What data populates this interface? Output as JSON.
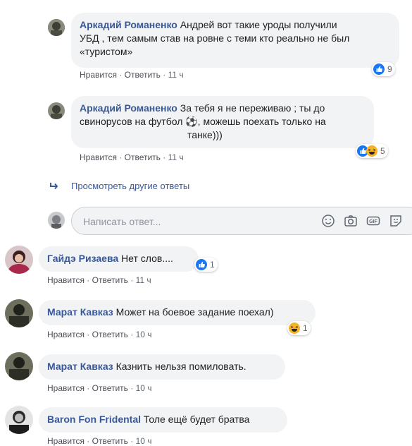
{
  "comments": [
    {
      "id": "c1",
      "author": "Аркадий Романенко",
      "text_lines": [
        "Андрей вот такие уроды получили",
        "УБД , тем самым став на ровне с теми кто реально не был",
        "«туристом»"
      ],
      "actions": {
        "like": "Нравится",
        "reply": "Ответить",
        "time": "11 ч"
      },
      "reaction_count": "9",
      "reactions": [
        "like-icon"
      ]
    },
    {
      "id": "c2",
      "author": "Аркадий Романенко",
      "text_lines": [
        "За тебя я не переживаю ; ты до",
        "свинорусов на футбол ⚽, можешь поехать только на",
        "танке)))"
      ],
      "actions": {
        "like": "Нравится",
        "reply": "Ответить",
        "time": "11 ч"
      },
      "reaction_count": "5",
      "reactions": [
        "like-icon",
        "haha-icon"
      ]
    },
    {
      "id": "c3",
      "author": "Гайдэ Ризаева",
      "text": "Нет слов....",
      "actions": {
        "like": "Нравится",
        "reply": "Ответить",
        "time": "11 ч"
      },
      "reaction_count": "1",
      "reactions": [
        "like-icon"
      ]
    },
    {
      "id": "c4",
      "author": "Марат Кавказ",
      "text": "Может на боевое задание поехал)",
      "actions": {
        "like": "Нравится",
        "reply": "Ответить",
        "time": "10 ч"
      },
      "reaction_count": "1",
      "reactions": [
        "haha-icon"
      ]
    },
    {
      "id": "c5",
      "author": "Марат Кавказ",
      "text": "Казнить нельзя помиловать.",
      "actions": {
        "like": "Нравится",
        "reply": "Ответить",
        "time": "10 ч"
      }
    },
    {
      "id": "c6",
      "author": "Baron Fon Fridental",
      "text": "Толе ещё будет братва",
      "actions": {
        "like": "Нравится",
        "reply": "Ответить",
        "time": "10 ч"
      }
    }
  ],
  "more_replies": "Просмотреть другие ответы",
  "composer": {
    "placeholder": "Написать ответ...",
    "icons": [
      "emoji-icon",
      "camera-icon",
      "gif-icon",
      "sticker-icon"
    ]
  },
  "colors": {
    "author": "#385898",
    "bubble": "#f2f3f5",
    "meta": "#606770",
    "like": "#1877f2",
    "haha": "#f7b125"
  }
}
